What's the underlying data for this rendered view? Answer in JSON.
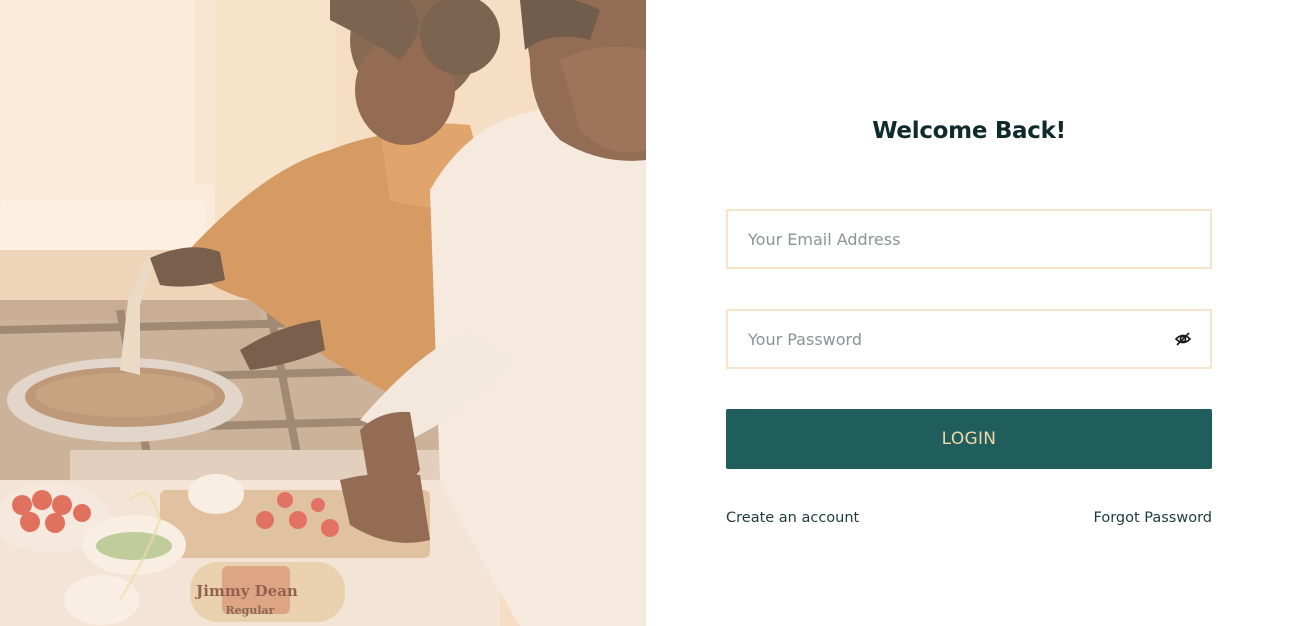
{
  "login": {
    "title": "Welcome Back!",
    "email_placeholder": "Your Email Address",
    "email_value": "",
    "password_placeholder": "Your Password",
    "password_value": "",
    "login_label": "LOGIN",
    "create_account_label": "Create an account",
    "forgot_password_label": "Forgot Password"
  },
  "hero": {
    "package_brand": "Jimmy Dean",
    "package_variant": "Regular"
  },
  "icons": {
    "password_toggle": "eye-slash-icon"
  },
  "colors": {
    "primary": "#205e5e",
    "button_text": "#f4d7a8",
    "field_border": "#f7e4cb",
    "heading": "#0e2a2a"
  }
}
